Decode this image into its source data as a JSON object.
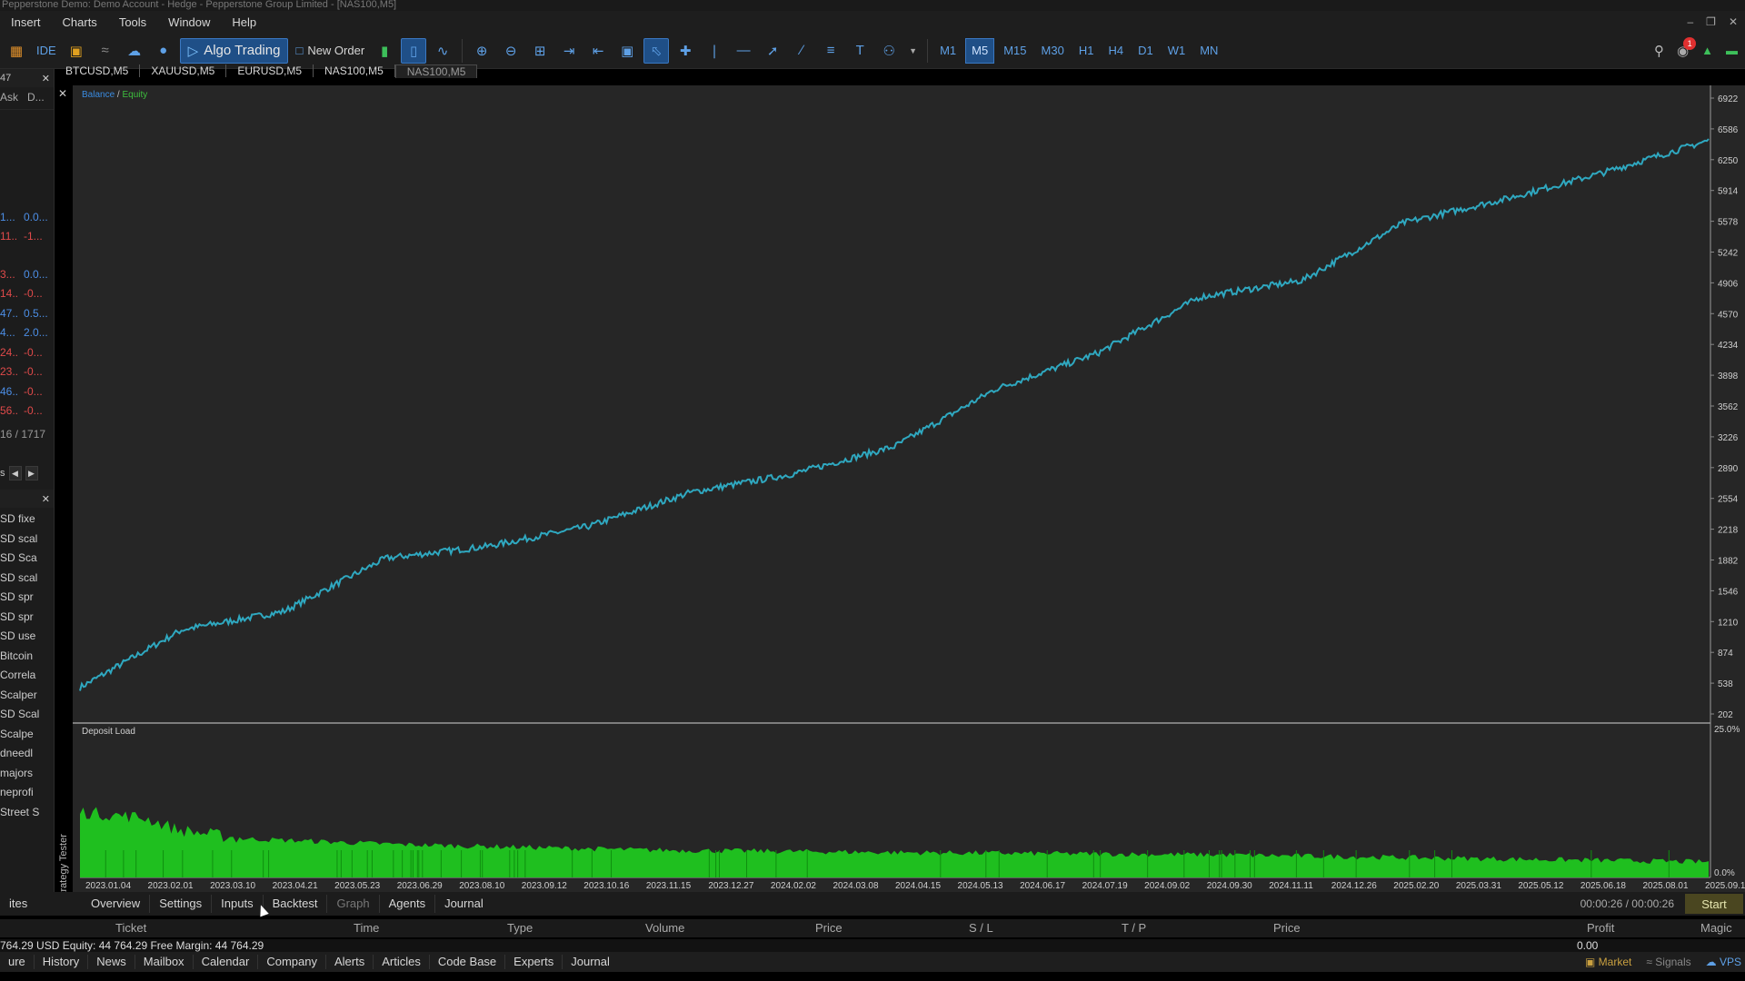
{
  "window": {
    "title": "Pepperstone Demo: Demo Account - Hedge - Pepperstone Group Limited - [NAS100,M5]"
  },
  "menu": [
    "Insert",
    "Charts",
    "Tools",
    "Window",
    "Help"
  ],
  "toolbar": {
    "ide_label": "IDE",
    "algo_trading_label": "Algo Trading",
    "new_order_label": "New Order",
    "notification_count": "1",
    "timeframes": [
      "M1",
      "M5",
      "M15",
      "M30",
      "H1",
      "H4",
      "D1",
      "W1",
      "MN"
    ],
    "active_timeframe": "M5"
  },
  "market_watch": {
    "header_left": "47",
    "col_ask": "Ask",
    "col_d": "D...",
    "rows": [
      {
        "bid": "1...",
        "chg": "0.0...",
        "bid_color": "blue",
        "chg_color": "blue"
      },
      {
        "bid": "11...",
        "chg": "-1...",
        "bid_color": "red",
        "chg_color": "red"
      },
      {
        "bid": "3...",
        "chg": "0.0...",
        "bid_color": "red",
        "chg_color": "blue"
      },
      {
        "bid": "14...",
        "chg": "-0...",
        "bid_color": "red",
        "chg_color": "red"
      },
      {
        "bid": "47...",
        "chg": "0.5...",
        "bid_color": "blue",
        "chg_color": "blue"
      },
      {
        "bid": "4...",
        "chg": "2.0...",
        "bid_color": "blue",
        "chg_color": "blue"
      },
      {
        "bid": "24...",
        "chg": "-0...",
        "bid_color": "red",
        "chg_color": "red"
      },
      {
        "bid": "23...",
        "chg": "-0...",
        "bid_color": "red",
        "chg_color": "red"
      },
      {
        "bid": "46...",
        "chg": "-0...",
        "bid_color": "blue",
        "chg_color": "red"
      },
      {
        "bid": "56...",
        "chg": "-0...",
        "bid_color": "red",
        "chg_color": "red"
      }
    ],
    "count": "16 / 1717"
  },
  "navigator": {
    "tab_label": "s",
    "items": [
      "SD fixe",
      "SD scal",
      "SD Sca",
      "SD scal",
      "SD spr",
      "SD spr",
      "SD use",
      "Bitcoin",
      "Correla",
      "Scalper",
      "SD Scal",
      "Scalpe",
      "dneedl",
      "majors",
      "neprofi",
      "Street S"
    ]
  },
  "chart_tabs": [
    "BTCUSD,M5",
    "XAUUSD,M5",
    "EURUSD,M5",
    "NAS100,M5",
    "NAS100,M5"
  ],
  "chart_data": {
    "type": "line",
    "legend": {
      "balance": "Balance",
      "separator": "/",
      "equity": "Equity"
    },
    "series": [
      {
        "name": "Balance",
        "color": "#2fa8c0",
        "x": [
          "2023.01.04",
          "2023.03.10",
          "2023.05.23",
          "2023.08.10",
          "2023.10.16",
          "2023.12.27",
          "2024.03.08",
          "2024.05.13",
          "2024.07.19",
          "2024.09.30",
          "2024.11.11",
          "2024.12.26",
          "2025.02.03",
          "2025.02.20",
          "2025.03.31",
          "2025.06.18",
          "2025.09.12"
        ],
        "values": [
          490,
          1120,
          1320,
          1900,
          2030,
          2250,
          2620,
          2820,
          3120,
          3750,
          4140,
          4750,
          4930,
          5560,
          5820,
          6120,
          6460
        ]
      }
    ],
    "y_ticks": [
      "6922",
      "6586",
      "6250",
      "5914",
      "5578",
      "5242",
      "4906",
      "4570",
      "4234",
      "3898",
      "3562",
      "3226",
      "2890",
      "2554",
      "2218",
      "1882",
      "1546",
      "1210",
      "874",
      "538",
      "202"
    ],
    "ylim": [
      202,
      6922
    ],
    "x_ticks": [
      "2023.01.04",
      "2023.02.01",
      "2023.03.10",
      "2023.04.21",
      "2023.05.23",
      "2023.06.29",
      "2023.08.10",
      "2023.09.12",
      "2023.10.16",
      "2023.11.15",
      "2023.12.27",
      "2024.02.02",
      "2024.03.08",
      "2024.04.15",
      "2024.05.13",
      "2024.06.17",
      "2024.07.19",
      "2024.09.02",
      "2024.09.30",
      "2024.11.11",
      "2024.12.26",
      "2025.02.20",
      "2025.03.31",
      "2025.05.12",
      "2025.06.18",
      "2025.08.01",
      "2025.09.12"
    ],
    "deposit_load": {
      "label": "Deposit Load",
      "y_ticks": [
        "25.0%",
        "0.0%"
      ],
      "ylim": [
        0,
        25
      ],
      "color": "#1fbf1f",
      "points": [
        [
          0,
          11
        ],
        [
          0.04,
          10
        ],
        [
          0.06,
          8
        ],
        [
          0.1,
          6.5
        ],
        [
          0.2,
          5.5
        ],
        [
          0.35,
          4.6
        ],
        [
          0.5,
          4.2
        ],
        [
          0.7,
          3.8
        ],
        [
          0.85,
          3.2
        ],
        [
          1.0,
          2.6
        ]
      ]
    }
  },
  "tester_tabs": [
    "Overview",
    "Settings",
    "Inputs",
    "Backtest",
    "Graph",
    "Agents",
    "Journal"
  ],
  "tester_label": "Strategy Tester",
  "favorites_label": "ites",
  "time_status": "00:00:26 / 00:00:26",
  "start_label": "Start",
  "table_columns": [
    "Ticket",
    "Time",
    "Type",
    "Volume",
    "Price",
    "S / L",
    "T / P",
    "Price",
    "Profit",
    "Magic"
  ],
  "account": {
    "summary": "764.29 USD  Equity: 44 764.29  Free Margin: 44 764.29",
    "profit": "0.00"
  },
  "status_tabs": [
    "ure",
    "History",
    "News",
    "Mailbox",
    "Calendar",
    "Company",
    "Alerts",
    "Articles",
    "Code Base",
    "Experts",
    "Journal"
  ],
  "status_right": {
    "market": "Market",
    "signals": "Signals",
    "vps": "VPS"
  }
}
